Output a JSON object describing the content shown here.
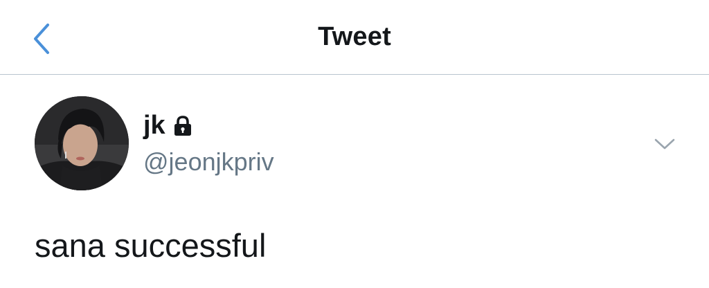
{
  "header": {
    "title": "Tweet",
    "back_icon": "chevron-left-icon"
  },
  "tweet": {
    "author": {
      "display_name": "jk",
      "handle": "@jeonjkpriv",
      "protected_icon": "lock-icon"
    },
    "menu_icon": "chevron-down-icon",
    "text": "sana successful"
  },
  "colors": {
    "accent": "#1da1f2",
    "back_chevron": "#4a90d9",
    "primary_text": "#14171a",
    "secondary_text": "#657786",
    "divider": "#b8c4ce"
  }
}
